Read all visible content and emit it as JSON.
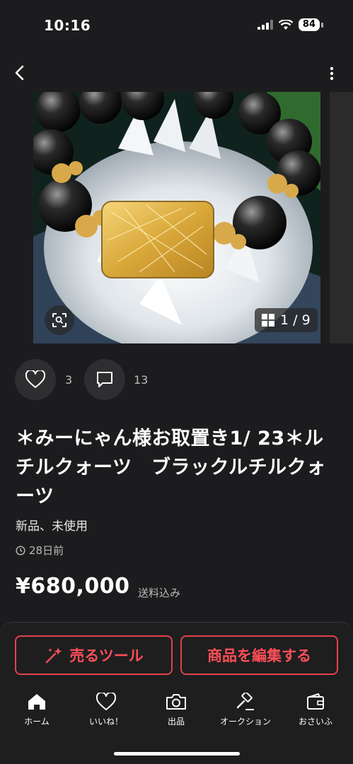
{
  "status": {
    "time": "10:16",
    "battery": "84"
  },
  "gallery": {
    "counter": "1 / 9"
  },
  "actions": {
    "likes": "3",
    "comments": "13"
  },
  "item": {
    "title": "＊みーにゃん様お取置き1/ 23＊ルチルクォーツ　ブラックルチルクォーツ",
    "condition": "新品、未使用",
    "posted": "28日前",
    "price": "¥680,000",
    "shipping": "送料込み"
  },
  "buttons": {
    "sell_tools": "売るツール",
    "edit_item": "商品を編集する"
  },
  "tabs": [
    {
      "label": "ホーム",
      "icon": "home-icon"
    },
    {
      "label": "いいね！",
      "icon": "heart-icon"
    },
    {
      "label": "出品",
      "icon": "camera-icon"
    },
    {
      "label": "オークション",
      "icon": "gavel-icon"
    },
    {
      "label": "おさいふ",
      "icon": "wallet-icon"
    }
  ],
  "colors": {
    "background": "#1c1c1e",
    "accent": "#e34149"
  }
}
